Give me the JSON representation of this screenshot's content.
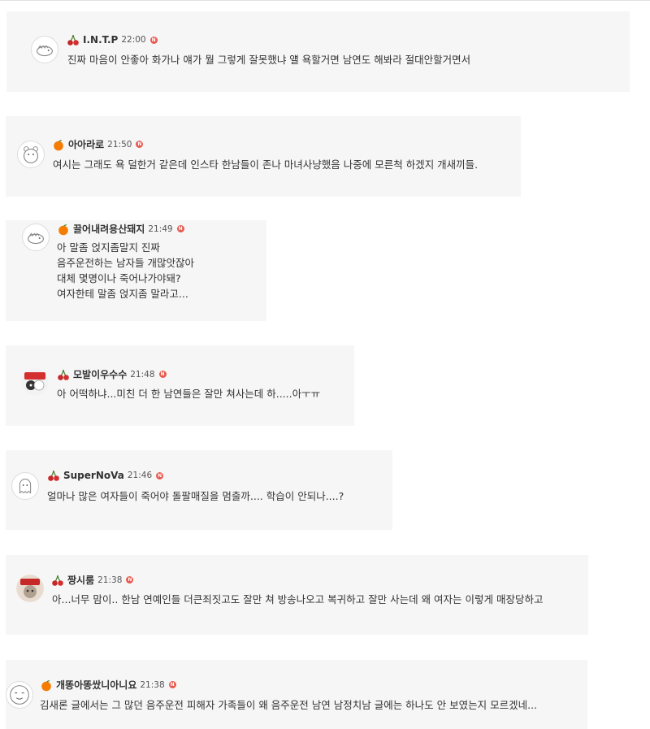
{
  "colors": {
    "card_bg": "#f6f6f6",
    "new_badge": "#e85a4f",
    "cherry": "#c62828",
    "orange": "#f57c00"
  },
  "new_badge_label": "N",
  "comments": [
    {
      "nickname": "I.N.T.P",
      "time": "22:00",
      "badge_icon": "cherry-icon",
      "avatar_icon": "dinosaur-avatar-icon",
      "lines": [
        "진짜 마음이 안좋아 화가나 얘가 뭘 그렇게 잘못했냐 얠 욕할거면 남연도 해봐라 절대안할거면서"
      ]
    },
    {
      "nickname": "아아라로",
      "time": "21:50",
      "badge_icon": "orange-icon",
      "avatar_icon": "bear-avatar-icon",
      "lines": [
        "여시는 그래도 욕 덜한거 같은데 인스타 한남들이 존나 마녀사냥했음 나중에 모른척 하겠지 개새끼들."
      ]
    },
    {
      "nickname": "끌어내려용산돼지",
      "time": "21:49",
      "badge_icon": "orange-icon",
      "avatar_icon": "dinosaur-avatar-icon",
      "lines": [
        "아 말좀 얹지좀말지 진짜",
        "음주운전하는 남자들 개많앗잖아",
        "대체 몇명이나 죽어나가야돼?",
        "여자한테 말좀 얹지좀 말라고..."
      ]
    },
    {
      "nickname": "모발이우수수",
      "time": "21:48",
      "badge_icon": "cherry-icon",
      "avatar_icon": "cat-photo-avatar-icon",
      "lines": [
        "아 어떡하냐...미친 더 한 남연들은 잘만 쳐사는데 하.....아ㅜㅠ"
      ]
    },
    {
      "nickname": "SuperNoVa",
      "time": "21:46",
      "badge_icon": "cherry-icon",
      "avatar_icon": "ghost-avatar-icon",
      "lines": [
        "얼마나 많은 여자들이 죽어야 돌팔매질을 멈출까.... 학습이 안되나....?"
      ]
    },
    {
      "nickname": "짱시룸",
      "time": "21:38",
      "badge_icon": "cherry-icon",
      "avatar_icon": "cat-photo-avatar-icon",
      "lines": [
        "아...너무 맘이.. 한남 연예인들 더큰죄짓고도 잘만 쳐 방송나오고 복귀하고 잘만 사는데 왜 여자는 이렇게 매장당하고"
      ]
    },
    {
      "nickname": "개똥아똥쌌니아니요",
      "time": "21:38",
      "badge_icon": "orange-icon",
      "avatar_icon": "doodle-face-avatar-icon",
      "lines": [
        "김새론 글에서는 그 많던 음주운전 피해자 가족들이 왜 음주운전 남연 남정치남 글에는 하나도 안 보였는지 모르겠네..."
      ]
    }
  ]
}
